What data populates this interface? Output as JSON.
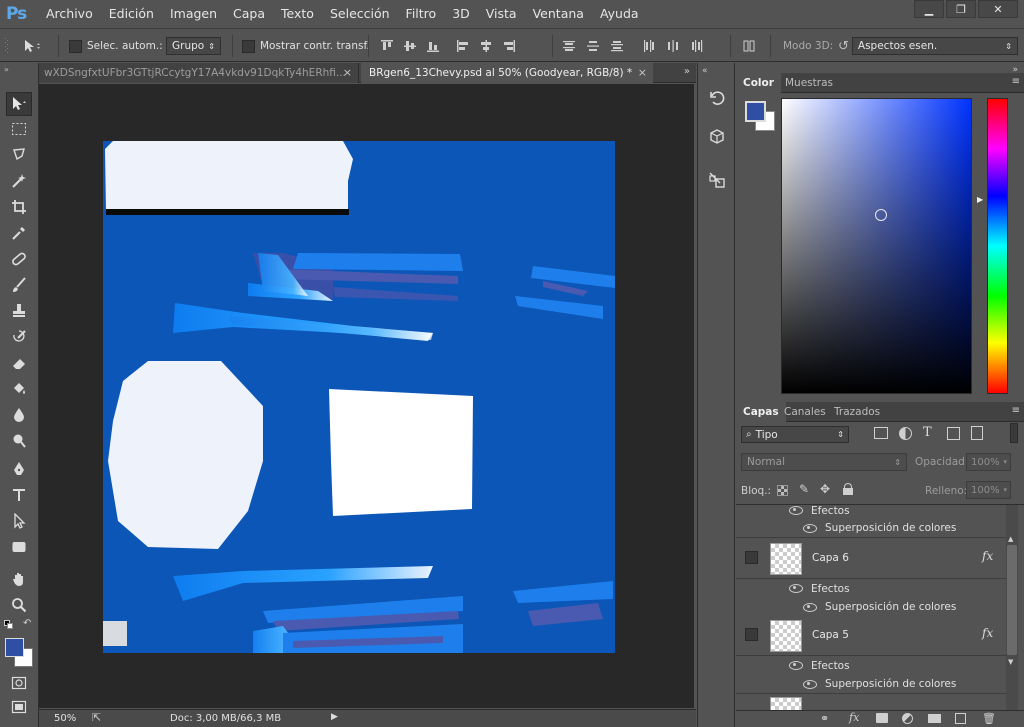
{
  "app": {
    "logo": "Ps"
  },
  "menu": [
    "Archivo",
    "Edición",
    "Imagen",
    "Capa",
    "Texto",
    "Selección",
    "Filtro",
    "3D",
    "Vista",
    "Ventana",
    "Ayuda"
  ],
  "window_controls": {
    "minimize": "▁",
    "restore": "❐",
    "close": "✕"
  },
  "options_bar": {
    "auto_select_label": "Selec. autom.:",
    "auto_select_value": "Grupo",
    "show_transform_label": "Mostrar contr. transf.",
    "mode3d_label": "Modo 3D:",
    "workspace_value": "Aspectos esen."
  },
  "tabs": [
    {
      "title": "wXDSngfxtUFbr3GTtjRCcytgY17A4vkdv91DqkTy4hERhfi...",
      "close": "×",
      "active": false
    },
    {
      "title": "BRgen6_13Chevy.psd al 50% (Goodyear, RGB/8) *",
      "close": "×",
      "active": true
    }
  ],
  "status": {
    "zoom": "50%",
    "doc": "Doc: 3,00 MB/66,3 MB"
  },
  "color_panel": {
    "tabs": [
      "Color",
      "Muestras"
    ],
    "foreground": "#2e4fa3",
    "background": "#ffffff",
    "hue": "#0033ff"
  },
  "layers_panel": {
    "tabs": [
      "Capas",
      "Canales",
      "Trazados"
    ],
    "filter_value": "Tipo",
    "blend_mode": "Normal",
    "opacity_label": "Opacidad:",
    "opacity_value": "100%",
    "lock_label": "Bloq.:",
    "fill_label": "Relleno:",
    "fill_value": "100%",
    "top_sub": {
      "effects": "Efectos",
      "overlay": "Superposición de colores"
    },
    "layers": [
      {
        "name": "Capa 6",
        "fx": "fx",
        "effects": "Efectos",
        "overlay": "Superposición de colores"
      },
      {
        "name": "Capa 5",
        "fx": "fx",
        "effects": "Efectos",
        "overlay": "Superposición de colores"
      }
    ]
  }
}
